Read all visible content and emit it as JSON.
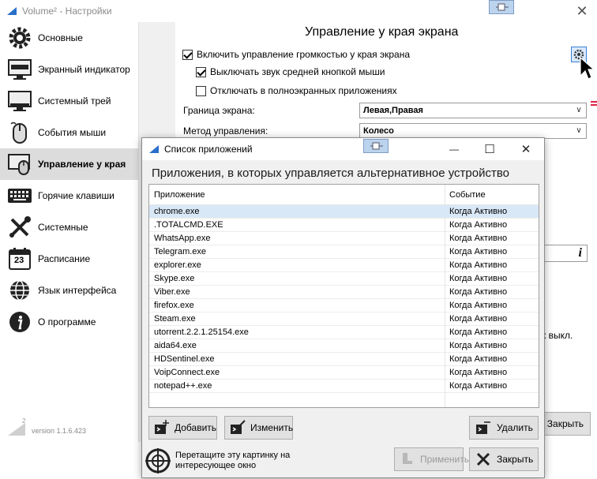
{
  "window": {
    "title": "Volume² - Настройки",
    "close_glyph": "✕",
    "version": "version 1.1.6.423"
  },
  "sidebar": {
    "items": [
      {
        "label": "Основные",
        "icon": "gear-icon"
      },
      {
        "label": "Экранный индикатор",
        "icon": "monitor-indicator-icon"
      },
      {
        "label": "Системный трей",
        "icon": "system-tray-icon"
      },
      {
        "label": "События мыши",
        "icon": "mouse-icon"
      },
      {
        "label": "Управление у края",
        "icon": "screen-edge-mouse-icon",
        "active": true
      },
      {
        "label": "Горячие клавиши",
        "icon": "keyboard-icon"
      },
      {
        "label": "Системные",
        "icon": "tools-icon"
      },
      {
        "label": "Расписание",
        "icon": "calendar-icon",
        "calendar_day": "23"
      },
      {
        "label": "Язык интерфейса",
        "icon": "globe-icon"
      },
      {
        "label": "О программе",
        "icon": "info-icon"
      }
    ]
  },
  "main": {
    "section_title": "Управление у края экрана",
    "enable_label": "Включить управление громкостью у края экрана",
    "mute_middle_label": "Выключать звук средней кнопкой мыши",
    "fullscreen_label": "Отключать в полноэкранных приложениях",
    "border_label": "Граница экрана:",
    "border_value": "Левая,Правая",
    "method_label": "Метод управления:",
    "method_value": "Колесо",
    "side_text": "к выкл.",
    "close_label": "Закрыть",
    "info_glyph": "i"
  },
  "dialog": {
    "title": "Список приложений",
    "heading": "Приложения, в которых управляется альтернативное устройство",
    "col_app": "Приложение",
    "col_event": "Событие",
    "rows": [
      {
        "app": "chrome.exe",
        "event": "Когда Активно"
      },
      {
        "app": ".TOTALCMD.EXE",
        "event": "Когда Активно"
      },
      {
        "app": "WhatsApp.exe",
        "event": "Когда Активно"
      },
      {
        "app": "Telegram.exe",
        "event": "Когда Активно"
      },
      {
        "app": "explorer.exe",
        "event": "Когда Активно"
      },
      {
        "app": "Skype.exe",
        "event": "Когда Активно"
      },
      {
        "app": "Viber.exe",
        "event": "Когда Активно"
      },
      {
        "app": "firefox.exe",
        "event": "Когда Активно"
      },
      {
        "app": "Steam.exe",
        "event": "Когда Активно"
      },
      {
        "app": "utorrent.2.2.1.25154.exe",
        "event": "Когда Активно"
      },
      {
        "app": "aida64.exe",
        "event": "Когда Активно"
      },
      {
        "app": "HDSentinel.exe",
        "event": "Когда Активно"
      },
      {
        "app": "VoipConnect.exe",
        "event": "Когда Активно"
      },
      {
        "app": "notepad++.exe",
        "event": "Когда Активно"
      }
    ],
    "add_label": "Добавить",
    "edit_label": "Изменить",
    "delete_label": "Удалить",
    "apply_label": "Применить",
    "close_label": "Закрыть",
    "drag_hint_line1": "Перетащите эту картинку на",
    "drag_hint_line2": "интересующее окно",
    "minimize_glyph": "—",
    "maximize_glyph": "☐",
    "close_glyph": "✕"
  },
  "colors": {
    "selection": "#d9e8f7",
    "accent": "#3c7fd8",
    "active_nav": "#dcdcdc"
  }
}
